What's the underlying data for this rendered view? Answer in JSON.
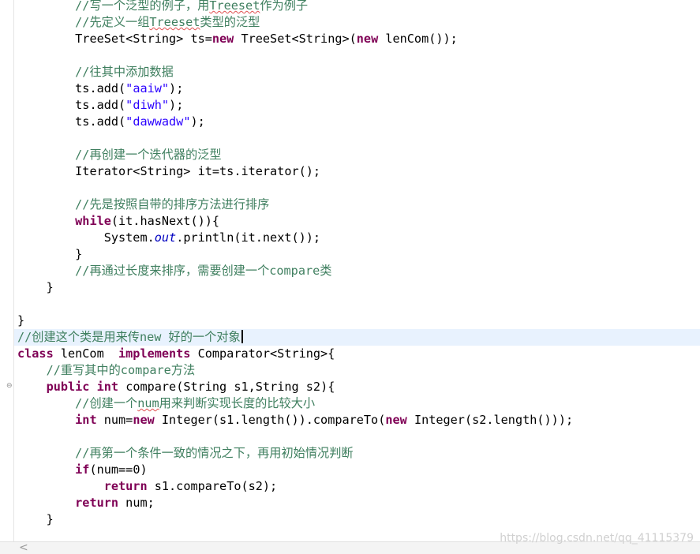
{
  "editor": {
    "lines": [
      {
        "indent": "        ",
        "tokens": [
          [
            "cm",
            "//写一个泛型的例子，用"
          ],
          [
            "cm sq",
            "Treeset"
          ],
          [
            "cm",
            "作为例子"
          ]
        ]
      },
      {
        "indent": "        ",
        "tokens": [
          [
            "cm",
            "//先定义一组"
          ],
          [
            "cm sq",
            "Treeset"
          ],
          [
            "cm",
            "类型的泛型"
          ]
        ]
      },
      {
        "indent": "        ",
        "tokens": [
          [
            "t",
            "TreeSet<String> ts="
          ],
          [
            "kw",
            "new"
          ],
          [
            "t",
            " TreeSet<String>("
          ],
          [
            "kw",
            "new"
          ],
          [
            "t",
            " lenCom());"
          ]
        ]
      },
      {
        "indent": "",
        "tokens": []
      },
      {
        "indent": "        ",
        "tokens": [
          [
            "cm",
            "//往其中添加数据"
          ]
        ]
      },
      {
        "indent": "        ",
        "tokens": [
          [
            "t",
            "ts.add("
          ],
          [
            "st",
            "\"aaiw\""
          ],
          [
            "t",
            ");"
          ]
        ]
      },
      {
        "indent": "        ",
        "tokens": [
          [
            "t",
            "ts.add("
          ],
          [
            "st",
            "\"diwh\""
          ],
          [
            "t",
            ");"
          ]
        ]
      },
      {
        "indent": "        ",
        "tokens": [
          [
            "t",
            "ts.add("
          ],
          [
            "st",
            "\"dawwadw\""
          ],
          [
            "t",
            ");"
          ]
        ]
      },
      {
        "indent": "",
        "tokens": []
      },
      {
        "indent": "        ",
        "tokens": [
          [
            "cm",
            "//再创建一个迭代器的泛型"
          ]
        ]
      },
      {
        "indent": "        ",
        "tokens": [
          [
            "t",
            "Iterator<String> it=ts.iterator();"
          ]
        ]
      },
      {
        "indent": "",
        "tokens": []
      },
      {
        "indent": "        ",
        "tokens": [
          [
            "cm",
            "//先是按照自带的排序方法进行排序"
          ]
        ]
      },
      {
        "indent": "        ",
        "tokens": [
          [
            "kw",
            "while"
          ],
          [
            "t",
            "(it.hasNext()){"
          ]
        ]
      },
      {
        "indent": "            ",
        "tokens": [
          [
            "t",
            "System."
          ],
          [
            "fi",
            "out"
          ],
          [
            "t",
            ".println(it.next());"
          ]
        ]
      },
      {
        "indent": "        ",
        "tokens": [
          [
            "t",
            "}"
          ]
        ]
      },
      {
        "indent": "        ",
        "tokens": [
          [
            "cm",
            "//再通过长度来排序，需要创建一个compare类"
          ]
        ]
      },
      {
        "indent": "    ",
        "tokens": [
          [
            "t",
            "}"
          ]
        ]
      },
      {
        "indent": "",
        "tokens": []
      },
      {
        "indent": "",
        "tokens": [
          [
            "t",
            "}"
          ]
        ]
      },
      {
        "indent": "",
        "current": true,
        "caret": true,
        "tokens": [
          [
            "cm",
            "//创建这个类是用来传new 好的一个对象"
          ]
        ]
      },
      {
        "indent": "",
        "tokens": [
          [
            "kw",
            "class"
          ],
          [
            "t",
            " lenCom  "
          ],
          [
            "kw",
            "implements"
          ],
          [
            "t",
            " Comparator<String>{"
          ]
        ]
      },
      {
        "indent": "    ",
        "tokens": [
          [
            "cm",
            "//重写其中的compare方法"
          ]
        ]
      },
      {
        "indent": "    ",
        "tokens": [
          [
            "kw",
            "public"
          ],
          [
            "t",
            " "
          ],
          [
            "kw",
            "int"
          ],
          [
            "t",
            " compare(String s1,String s2){"
          ]
        ]
      },
      {
        "indent": "        ",
        "tokens": [
          [
            "cm",
            "//创建一个"
          ],
          [
            "cm sq",
            "num"
          ],
          [
            "cm",
            "用来判断实现长度的比较大小"
          ]
        ]
      },
      {
        "indent": "        ",
        "tokens": [
          [
            "kw",
            "int"
          ],
          [
            "t",
            " num="
          ],
          [
            "kw",
            "new"
          ],
          [
            "t",
            " Integer(s1.length()).compareTo("
          ],
          [
            "kw",
            "new"
          ],
          [
            "t",
            " Integer(s2.length()));"
          ]
        ]
      },
      {
        "indent": "",
        "tokens": []
      },
      {
        "indent": "        ",
        "tokens": [
          [
            "cm",
            "//再第一个条件一致的情况之下，再用初始情况判断"
          ]
        ]
      },
      {
        "indent": "        ",
        "tokens": [
          [
            "kw",
            "if"
          ],
          [
            "t",
            "(num==0)"
          ]
        ]
      },
      {
        "indent": "            ",
        "tokens": [
          [
            "kw",
            "return"
          ],
          [
            "t",
            " s1.compareTo(s2);"
          ]
        ]
      },
      {
        "indent": "        ",
        "tokens": [
          [
            "kw",
            "return"
          ],
          [
            "t",
            " num;"
          ]
        ]
      },
      {
        "indent": "    ",
        "tokens": [
          [
            "t",
            "}"
          ]
        ]
      }
    ]
  },
  "ruler": {
    "fold_marker": "⊖"
  },
  "scrollbar": {
    "left_arrow": "<"
  },
  "watermark": "https://blog.csdn.net/qq_41115379"
}
